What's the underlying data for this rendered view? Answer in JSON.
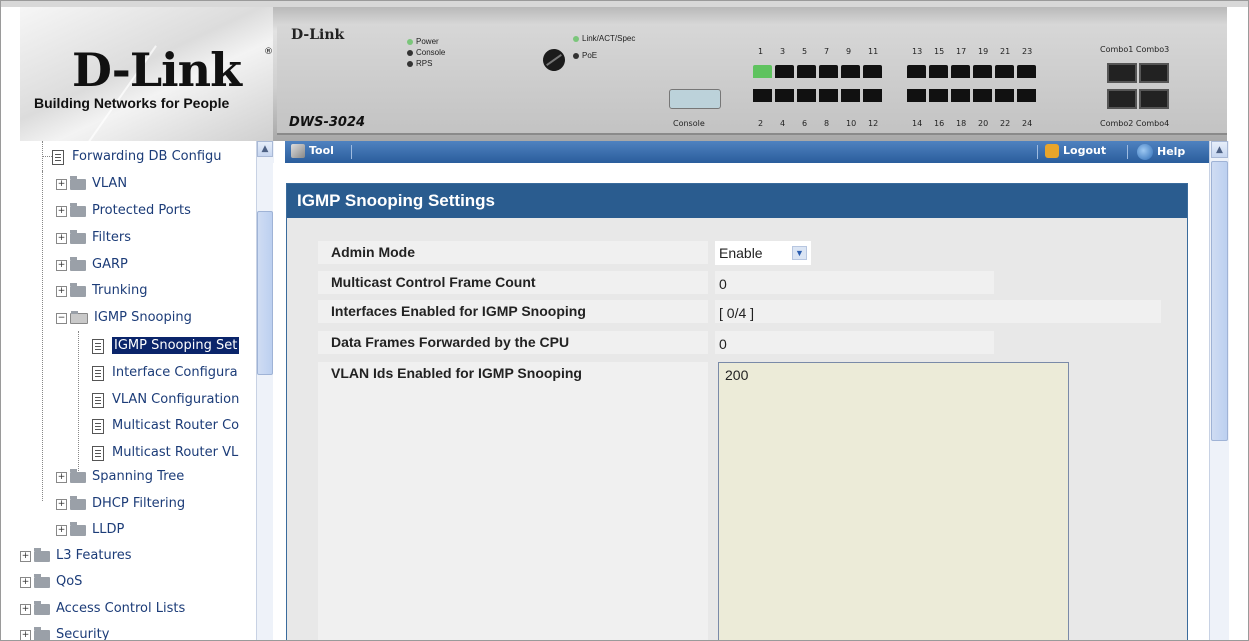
{
  "branding": {
    "logo_text": "D-Link",
    "tagline": "Building Networks for People"
  },
  "device": {
    "logo": "D-Link",
    "model": "DWS-3024",
    "leds": [
      {
        "label": "Power",
        "color": "#7bc67b"
      },
      {
        "label": "Console",
        "color": "#333333"
      },
      {
        "label": "RPS",
        "color": "#333333"
      },
      {
        "label": "Link/ACT/Spec",
        "color": "#7bc67b"
      },
      {
        "label": "PoE",
        "color": "#333333"
      }
    ],
    "console_label": "Console",
    "ports_top": [
      "1",
      "3",
      "5",
      "7",
      "9",
      "11",
      "13",
      "15",
      "17",
      "19",
      "21",
      "23"
    ],
    "ports_bottom": [
      "2",
      "4",
      "6",
      "8",
      "10",
      "12",
      "14",
      "16",
      "18",
      "20",
      "22",
      "24"
    ],
    "combo_top": "Combo1 Combo3",
    "combo_bottom": "Combo2 Combo4"
  },
  "toolbar": {
    "tool_label": "Tool",
    "logout_label": "Logout",
    "help_label": "Help"
  },
  "tree": {
    "items": [
      {
        "label": "Forwarding DB Configu",
        "type": "doc"
      },
      {
        "label": "VLAN",
        "type": "folder"
      },
      {
        "label": "Protected Ports",
        "type": "folder"
      },
      {
        "label": "Filters",
        "type": "folder"
      },
      {
        "label": "GARP",
        "type": "folder"
      },
      {
        "label": "Trunking",
        "type": "folder"
      },
      {
        "label": "IGMP Snooping",
        "type": "folder-open"
      },
      {
        "label": "IGMP Snooping Set",
        "type": "doc",
        "selected": true
      },
      {
        "label": "Interface Configura",
        "type": "doc"
      },
      {
        "label": "VLAN Configuration",
        "type": "doc"
      },
      {
        "label": "Multicast Router Co",
        "type": "doc"
      },
      {
        "label": "Multicast Router VL",
        "type": "doc"
      },
      {
        "label": "Spanning Tree",
        "type": "folder"
      },
      {
        "label": "DHCP Filtering",
        "type": "folder"
      },
      {
        "label": "LLDP",
        "type": "folder"
      },
      {
        "label": "L3 Features",
        "type": "folder"
      },
      {
        "label": "QoS",
        "type": "folder"
      },
      {
        "label": "Access Control Lists",
        "type": "folder"
      },
      {
        "label": "Security",
        "type": "folder"
      }
    ]
  },
  "settings": {
    "title": "IGMP Snooping Settings",
    "admin_mode_label": "Admin Mode",
    "admin_mode_value": "Enable",
    "mcast_count_label": "Multicast Control Frame Count",
    "mcast_count_value": "0",
    "interfaces_label": "Interfaces Enabled for IGMP Snooping",
    "interfaces_value": "[ 0/4 ]",
    "data_frames_label": "Data Frames Forwarded by the CPU",
    "data_frames_value": "0",
    "vlan_ids_label": "VLAN Ids Enabled for IGMP Snooping",
    "vlan_ids_value": "200"
  }
}
